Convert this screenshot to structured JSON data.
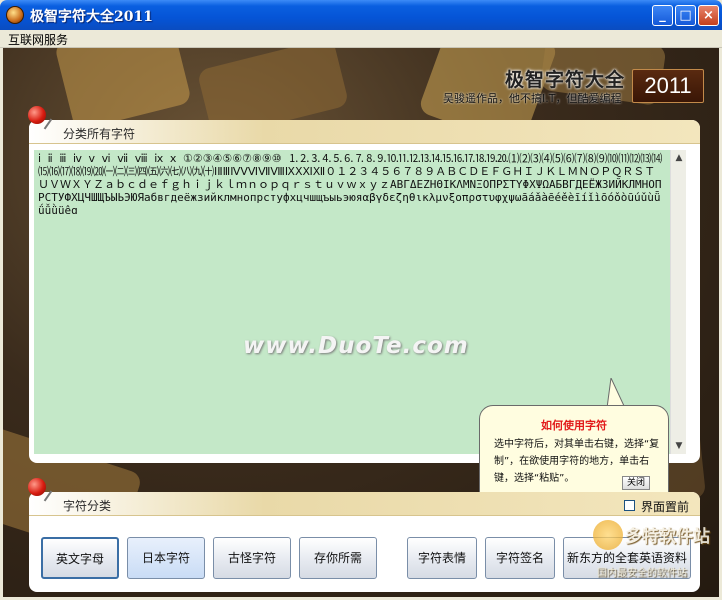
{
  "window": {
    "title": "极智字符大全2011",
    "minimize": "_",
    "maximize": "□",
    "close": "×"
  },
  "menu": {
    "items": [
      "互联网服务"
    ]
  },
  "brand": {
    "title": "极智字符大全",
    "year": "2011",
    "subtitle": "吴骏遥作品，他不搞I.T，但酷爱编程"
  },
  "characters_panel": {
    "title": "分类所有字符",
    "content": "ⅰ ⅱ ⅲ ⅳ ⅴ ⅵ ⅶ ⅷ ⅸ ⅹ ①②③④⑤⑥⑦⑧⑨⑩ ⒈⒉⒊⒋⒌⒍⒎⒏⒐⒑⒒⒓⒔⒕⒖⒗⒘⒙⒚⒛⑴⑵⑶⑷⑸⑹⑺⑻⑼⑽⑾⑿⒀⒁⒂⒃⒄⒅⒆⒇㈠㈡㈢㈣㈤㈥㈦㈧㈨㈩ⅠⅡⅢⅣⅤⅥⅦⅧⅨⅩⅪⅫ０１２３４５６７８９ＡＢＣＤＥＦＧＨＩＪＫＬＭＮＯＰＱＲＳＴＵＶＷＸＹＺａｂｃｄｅｆｇｈｉｊｋｌｍｎｏｐｑｒｓｔｕｖｗｘｙｚΑΒΓΔΕΖΗΘΙΚΛΜΝΞΟΠΡΣΤΥΦΧΨΩАБВГДЕЁЖЗИЙКЛМНОПРСТУФХЦЧШЩЪЫЬЭЮЯабвгдеёжзийклмнопрстуфхцчшщъыьэюяαβγδεζηθικλμνξοπρστυφχψωāáǎàēéěèīíǐìōóǒòūúǔùǖǘǚǜüêɑ",
    "watermark": "www.DuoTe.com"
  },
  "help_bubble": {
    "title": "如何使用字符",
    "body": "选中字符后，对其单击右键，选择“复制”，在欲使用字符的地方，单击右键，选择“粘贴”。",
    "close_label": "关闭"
  },
  "category_panel": {
    "title": "字符分类",
    "topmost_label": "界面置前",
    "topmost_checked": false,
    "buttons": [
      "英文字母",
      "日本字符",
      "古怪字符",
      "存你所需",
      "字符表情",
      "字符签名",
      "新东方的全套英语资料"
    ]
  },
  "corner_logo": {
    "main": "多特软件站",
    "sub": "国内最安全的软件站"
  },
  "colors": {
    "title_bar": "#0554d6",
    "char_area_bg": "#c4e8c8",
    "bubble_title": "#e21b1b"
  }
}
